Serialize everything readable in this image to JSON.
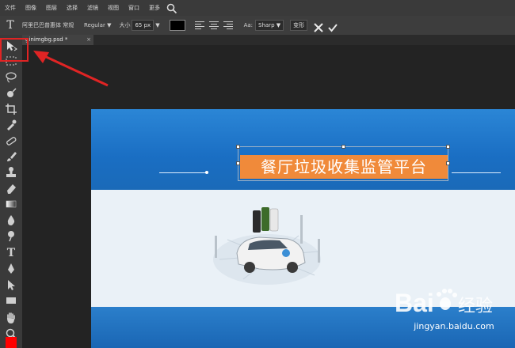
{
  "menu": [
    "文件",
    "图像",
    "图层",
    "选择",
    "滤镜",
    "视图",
    "窗口",
    "更多"
  ],
  "options": {
    "font_name": "阿里巴巴普惠体 常规",
    "font_style": "Regular ▼",
    "size_label": "大小",
    "size_value": "65 px",
    "size_arrow": "▼",
    "aa_label": "Aa:",
    "aa_value": "Sharp",
    "aa_arrow": "▼",
    "deform_label": "变形"
  },
  "document": {
    "tab_label": "ginimgbg.psd *",
    "title_text": "餐厅垃圾收集监管平台"
  },
  "watermark": {
    "url": "jingyan.baidu.com"
  },
  "colors": {
    "foreground": "#ff0000",
    "title_bg": "#f08a3a",
    "highlight": "#e02424"
  },
  "icons": [
    "move-icon",
    "marquee-icon",
    "lasso-icon",
    "quick-select-icon",
    "crop-icon",
    "eyedropper-icon",
    "healing-icon",
    "brush-icon",
    "stamp-icon",
    "eraser-icon",
    "gradient-icon",
    "blur-icon",
    "dodge-icon",
    "type-icon",
    "pen-icon",
    "path-select-icon",
    "shape-icon",
    "hand-icon",
    "zoom-icon"
  ]
}
